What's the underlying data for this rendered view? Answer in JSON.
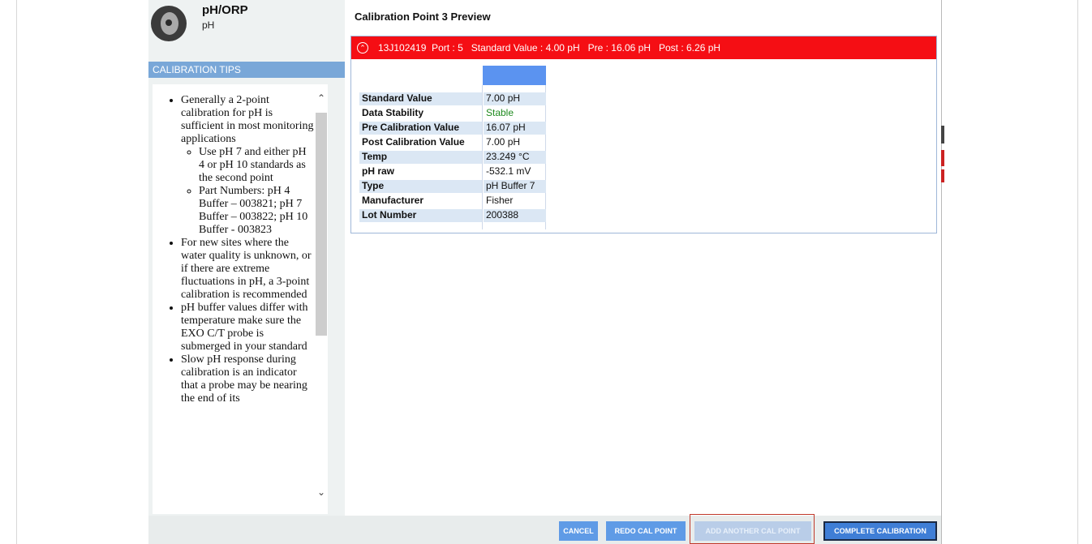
{
  "sensor": {
    "title": "pH/ORP",
    "subtitle": "pH"
  },
  "tips": {
    "header": "CALIBRATION TIPS",
    "items": [
      {
        "text": "Generally a 2-point calibration for pH is sufficient in most monitoring applications",
        "sub": [
          "Use pH 7 and either pH 4 or pH 10 standards as the second point",
          "Part Numbers: pH 4 Buffer – 003821; pH 7 Buffer – 003822; pH 10 Buffer - 003823"
        ]
      },
      {
        "text": "For new sites where the water quality is unknown, or if there are extreme fluctuations in pH, a 3-point calibration is recommended"
      },
      {
        "text": "pH buffer values differ with temperature make sure the EXO C/T probe is submerged in your standard"
      },
      {
        "text": "Slow pH response during calibration is an indicator that a probe may be nearing the end of its"
      }
    ]
  },
  "main": {
    "title": "Calibration Point  3  Preview",
    "bar_text": "13J102419  Port : 5   Standard Value : 4.00 pH   Pre : 16.06 pH   Post : 6.26 pH",
    "rows": [
      {
        "label": "Standard Value",
        "value": "7.00 pH"
      },
      {
        "label": "Data Stability",
        "value": "Stable"
      },
      {
        "label": "Pre Calibration Value",
        "value": "16.07 pH"
      },
      {
        "label": "Post Calibration Value",
        "value": "7.00 pH"
      },
      {
        "label": "Temp",
        "value": "23.249 °C"
      },
      {
        "label": "pH raw",
        "value": "-532.1 mV"
      },
      {
        "label": "Type",
        "value": "pH Buffer 7"
      },
      {
        "label": "Manufacturer",
        "value": "Fisher"
      },
      {
        "label": "Lot Number",
        "value": "200388"
      }
    ]
  },
  "buttons": {
    "cancel": "CANCEL",
    "redo": "REDO CAL POINT",
    "add": "ADD ANOTHER CAL POINT",
    "complete": "COMPLETE CALIBRATION"
  },
  "colors": {
    "alert_bar": "#f50e14",
    "tips_header": "#79a7d8",
    "button_blue": "#5f9be6",
    "stable_green": "#1f8a1f"
  }
}
